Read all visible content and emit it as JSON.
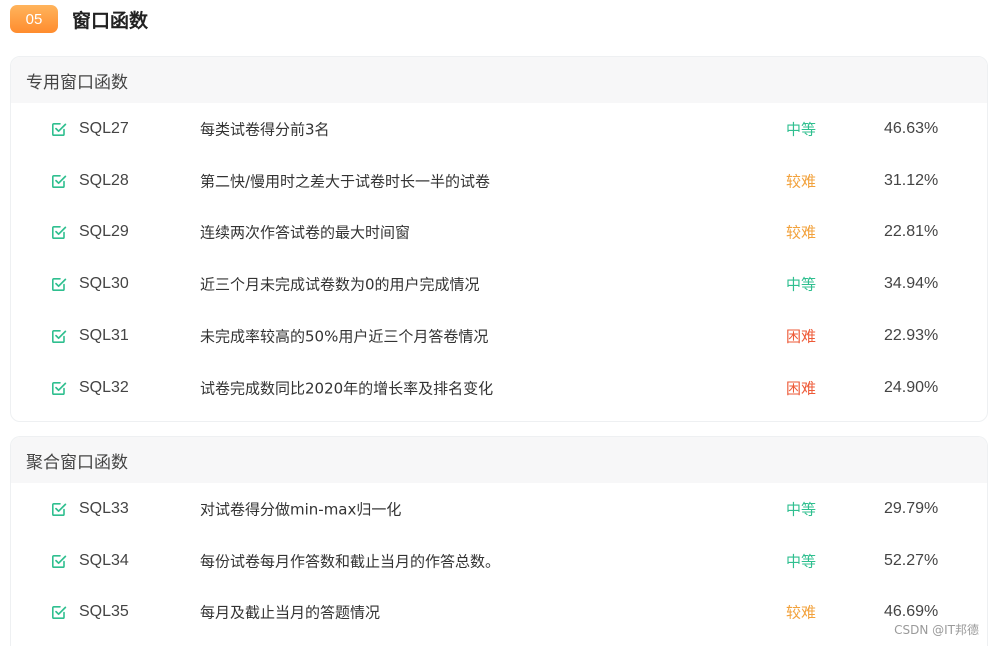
{
  "header": {
    "badge": "05",
    "title": "窗口函数"
  },
  "colors": {
    "medium": "#2fbf8f",
    "hard": "#f2a13b",
    "difficult": "#ee5a37",
    "check": "#2fbf8f"
  },
  "groups": [
    {
      "title": "专用窗口函数",
      "rows": [
        {
          "code": "SQL27",
          "title": "每类试卷得分前3名",
          "level": "中等",
          "level_key": "medium",
          "rate": "46.63%"
        },
        {
          "code": "SQL28",
          "title": "第二快/慢用时之差大于试卷时长一半的试卷",
          "level": "较难",
          "level_key": "hard",
          "rate": "31.12%"
        },
        {
          "code": "SQL29",
          "title": "连续两次作答试卷的最大时间窗",
          "level": "较难",
          "level_key": "hard",
          "rate": "22.81%"
        },
        {
          "code": "SQL30",
          "title": "近三个月未完成试卷数为0的用户完成情况",
          "level": "中等",
          "level_key": "medium",
          "rate": "34.94%"
        },
        {
          "code": "SQL31",
          "title": "未完成率较高的50%用户近三个月答卷情况",
          "level": "困难",
          "level_key": "difficult",
          "rate": "22.93%"
        },
        {
          "code": "SQL32",
          "title": "试卷完成数同比2020年的增长率及排名变化",
          "level": "困难",
          "level_key": "difficult",
          "rate": "24.90%"
        }
      ]
    },
    {
      "title": "聚合窗口函数",
      "rows": [
        {
          "code": "SQL33",
          "title": "对试卷得分做min-max归一化",
          "level": "中等",
          "level_key": "medium",
          "rate": "29.79%"
        },
        {
          "code": "SQL34",
          "title": "每份试卷每月作答数和截止当月的作答总数。",
          "level": "中等",
          "level_key": "medium",
          "rate": "52.27%"
        },
        {
          "code": "SQL35",
          "title": "每月及截止当月的答题情况",
          "level": "较难",
          "level_key": "hard",
          "rate": "46.69%"
        }
      ]
    }
  ],
  "watermark": "CSDN @IT邦德"
}
